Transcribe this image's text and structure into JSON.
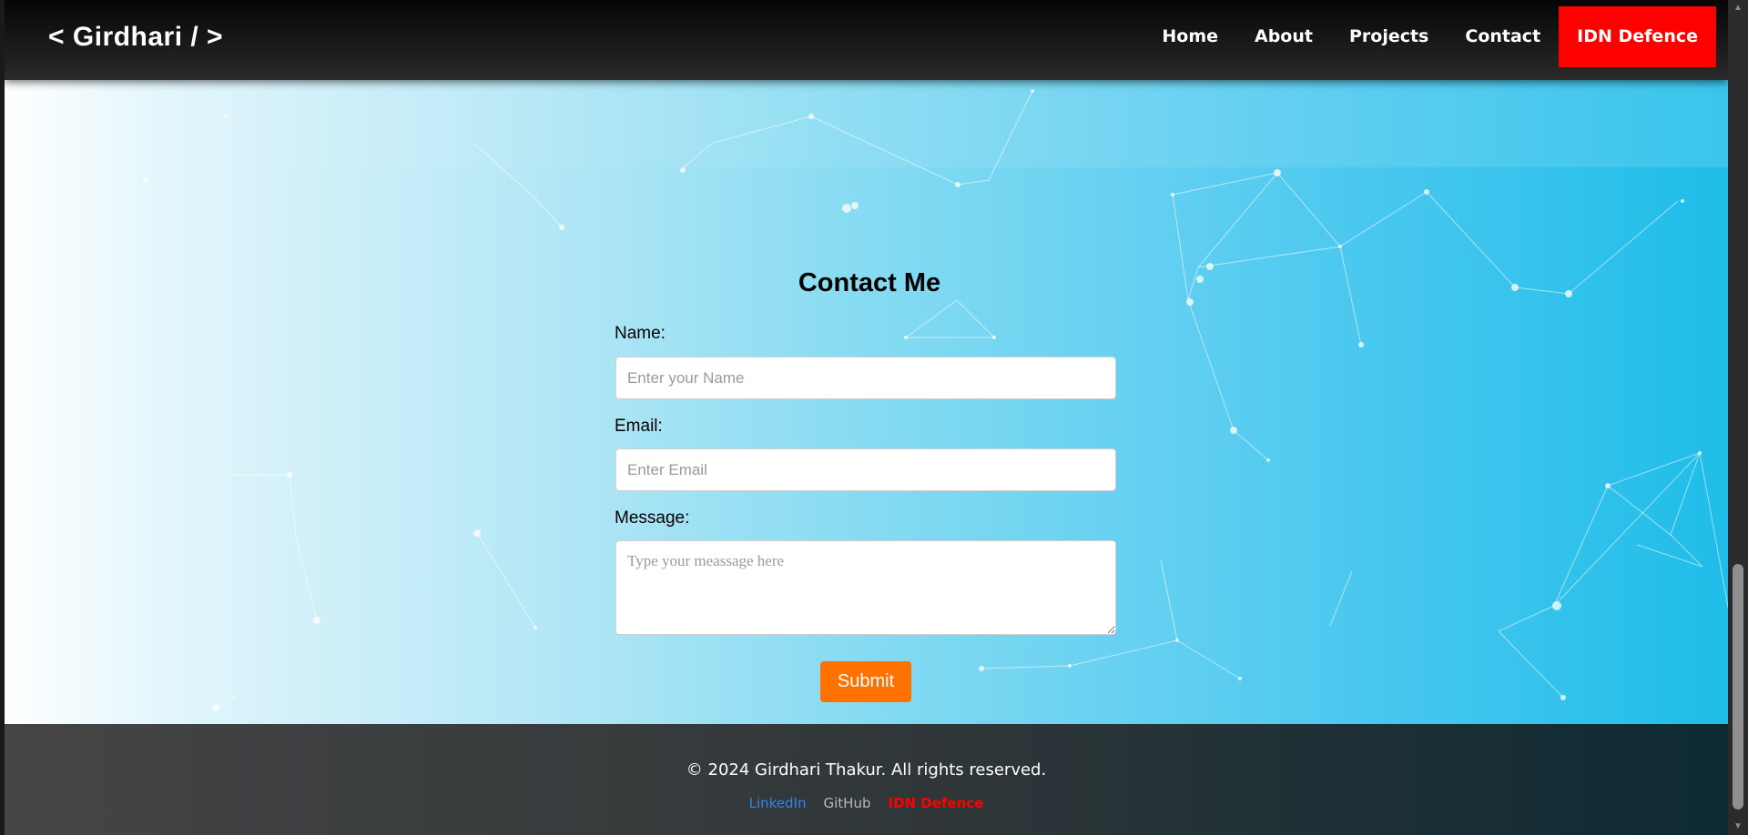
{
  "navbar": {
    "brand": "< Girdhari / >",
    "links": [
      {
        "label": "Home"
      },
      {
        "label": "About"
      },
      {
        "label": "Projects"
      },
      {
        "label": "Contact"
      }
    ],
    "cta_label": "IDN Defence"
  },
  "form": {
    "title": "Contact Me",
    "name_label": "Name:",
    "name_placeholder": "Enter your Name",
    "email_label": "Email:",
    "email_placeholder": "Enter Email",
    "message_label": "Message:",
    "message_placeholder": "Type your meassage here",
    "submit_label": "Submit"
  },
  "footer": {
    "copyright": "© 2024 Girdhari Thakur. All rights reserved.",
    "links": [
      {
        "label": "LinkedIn"
      },
      {
        "label": "GitHub"
      },
      {
        "label": "IDN Defence"
      }
    ]
  },
  "colors": {
    "cta": "#ff0000",
    "submit": "#ff7200",
    "linkedin": "#2d86e8",
    "idn": "#ff0000"
  },
  "icons": {
    "scroll_up": "triangle-up-icon",
    "scroll_down": "triangle-down-icon",
    "textarea_resize": "resize-grip-icon"
  }
}
